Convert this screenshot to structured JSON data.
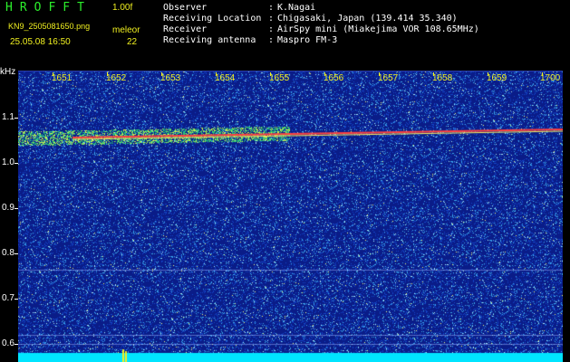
{
  "header": {
    "logo_text": "HROFFT",
    "version": "1.00f",
    "filename": "KN9_2505081650.png",
    "meleor_label": "meleor",
    "datetime": "25.05.08 16:50",
    "count": "22"
  },
  "info": [
    {
      "label": "Observer",
      "value": "K.Nagai"
    },
    {
      "label": "Receiving Location",
      "value": "Chigasaki, Japan (139.414 35.340)"
    },
    {
      "label": "Receiver",
      "value": "AirSpy mini (Miakejima VOR 108.65MHz)"
    },
    {
      "label": "Receiving antenna",
      "value": "Maspro FM-3"
    }
  ],
  "axis": {
    "y_unit": "kHz",
    "y_labels": [
      "1.1",
      "1.0",
      "0.9",
      "0.8",
      "0.7",
      "0.6"
    ],
    "x_labels": [
      "1651",
      "1652",
      "1653",
      "1654",
      "1655",
      "1656",
      "1657",
      "1658",
      "1659",
      "1700"
    ]
  },
  "colors": {
    "background": "#000000",
    "plot_noise_base": "#0a1c88",
    "trace": "#ff4040",
    "label_yellow": "#f0f020",
    "label_green": "#2cf02c",
    "baseline_cyan": "#00e5ff"
  }
}
